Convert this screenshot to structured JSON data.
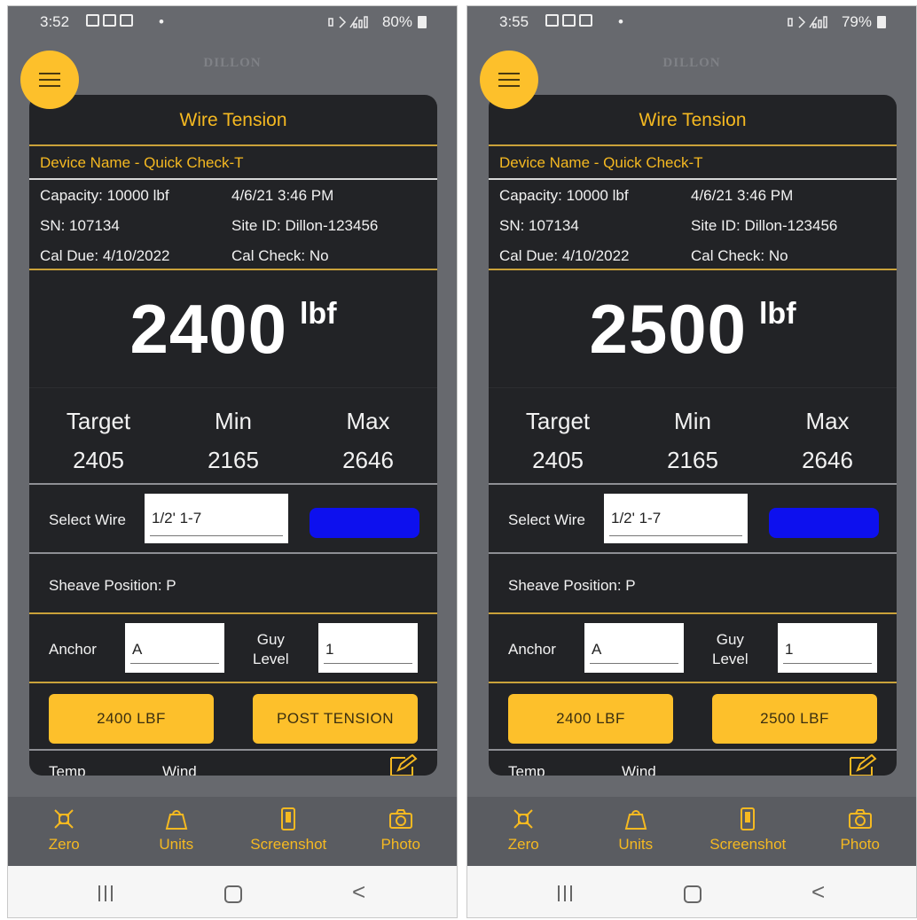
{
  "screens": [
    {
      "status": {
        "time": "3:52",
        "dot": "•",
        "right": "80%"
      },
      "brand": "DILLON",
      "title": "Wire Tension",
      "device_label": "Device Name  -  Quick Check-T",
      "capacity": "Capacity: 10000 lbf",
      "datetime": "4/6/21 3:46 PM",
      "sn": "SN: 107134",
      "site": "Site ID: Dillon-123456",
      "cal_due": "Cal Due:  4/10/2022",
      "cal_check": "Cal Check: No",
      "reading": "2400",
      "unit": "lbf",
      "target_label": "Target",
      "min_label": "Min",
      "max_label": "Max",
      "target": "2405",
      "min": "2165",
      "max": "2646",
      "select_wire_label": "Select Wire",
      "wire_value": "1/2' 1-7",
      "wire_color": "#0d10ee",
      "sheave": "Sheave Position:  P",
      "anchor_label": "Anchor",
      "anchor_value": "A",
      "guy_label_1": "Guy",
      "guy_label_2": "Level",
      "guy_value": "1",
      "button_left": "2400 LBF",
      "button_right": "POST TENSION",
      "temp_label": "Temp",
      "wind_label": "Wind",
      "nav": [
        "Zero",
        "Units",
        "Screenshot",
        "Photo"
      ]
    },
    {
      "status": {
        "time": "3:55",
        "dot": "•",
        "right": "79%"
      },
      "brand": "DILLON",
      "title": "Wire Tension",
      "device_label": "Device Name  -  Quick Check-T",
      "capacity": "Capacity: 10000 lbf",
      "datetime": "4/6/21 3:46 PM",
      "sn": "SN: 107134",
      "site": "Site ID: Dillon-123456",
      "cal_due": "Cal Due:  4/10/2022",
      "cal_check": "Cal Check: No",
      "reading": "2500",
      "unit": "lbf",
      "target_label": "Target",
      "min_label": "Min",
      "max_label": "Max",
      "target": "2405",
      "min": "2165",
      "max": "2646",
      "select_wire_label": "Select Wire",
      "wire_value": "1/2' 1-7",
      "wire_color": "#0d10ee",
      "sheave": "Sheave Position:  P",
      "anchor_label": "Anchor",
      "anchor_value": "A",
      "guy_label_1": "Guy",
      "guy_label_2": "Level",
      "guy_value": "1",
      "button_left": "2400 LBF",
      "button_right": "2500 LBF",
      "temp_label": "Temp",
      "wind_label": "Wind",
      "nav": [
        "Zero",
        "Units",
        "Screenshot",
        "Photo"
      ]
    }
  ]
}
